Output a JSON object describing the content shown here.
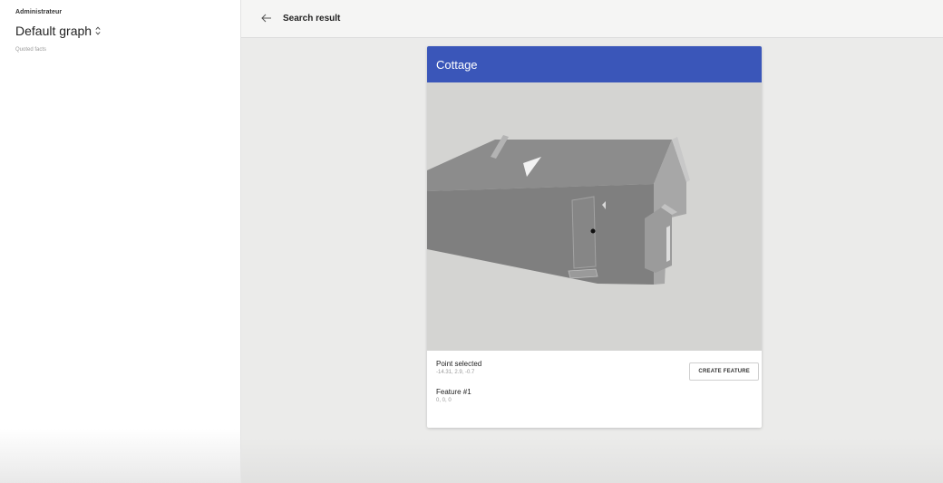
{
  "sidebar": {
    "role": "Administrateur",
    "graph_name": "Default graph",
    "section": "Quoted facts"
  },
  "topbar": {
    "title": "Search result"
  },
  "card": {
    "title": "Cottage",
    "header_color": "#3a56b9",
    "point_label": "Point selected",
    "point_value": "-14.31, 2.9, -0.7",
    "create_button": "CREATE FEATURE",
    "feature_label": "Feature #1",
    "feature_value": "0, 0, 0"
  },
  "icons": {
    "back": "arrow-left-icon",
    "graph_selector": "unfold-icon"
  }
}
